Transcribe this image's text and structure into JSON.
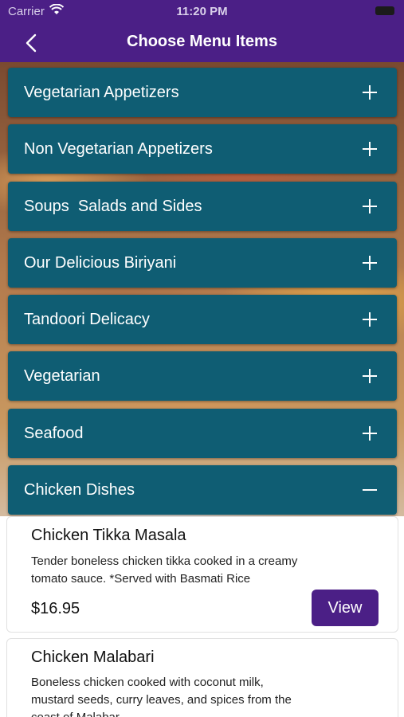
{
  "status_bar": {
    "carrier": "Carrier",
    "time": "11:20 PM"
  },
  "header": {
    "title": "Choose Menu Items"
  },
  "categories": [
    {
      "label": "Vegetarian Appetizers",
      "state": "collapsed"
    },
    {
      "label": "Non Vegetarian Appetizers",
      "state": "collapsed"
    },
    {
      "label": "Soups  Salads and Sides",
      "state": "collapsed"
    },
    {
      "label": "Our Delicious Biriyani",
      "state": "collapsed"
    },
    {
      "label": "Tandoori Delicacy",
      "state": "collapsed"
    },
    {
      "label": "Vegetarian",
      "state": "collapsed"
    },
    {
      "label": "Seafood",
      "state": "collapsed"
    },
    {
      "label": "Chicken Dishes",
      "state": "expanded"
    }
  ],
  "items": [
    {
      "name": "Chicken Tikka Masala",
      "desc_line1": "Tender boneless chicken tikka cooked in a creamy",
      "desc_line2": "tomato sauce. *Served with Basmati Rice",
      "price": "$16.95",
      "action_label": "View"
    },
    {
      "name": "Chicken Malabari",
      "desc_line1": "Boneless chicken cooked with coconut milk,",
      "desc_line2": "mustard seeds, curry leaves, and spices from the",
      "desc_line3": "coast of Malabar"
    }
  ],
  "colors": {
    "primary": "#4b1f86",
    "category_bar": "#0f5d73"
  },
  "icons": {
    "back": "chevron-left-icon",
    "expand": "plus-icon",
    "collapse": "minus-icon"
  }
}
